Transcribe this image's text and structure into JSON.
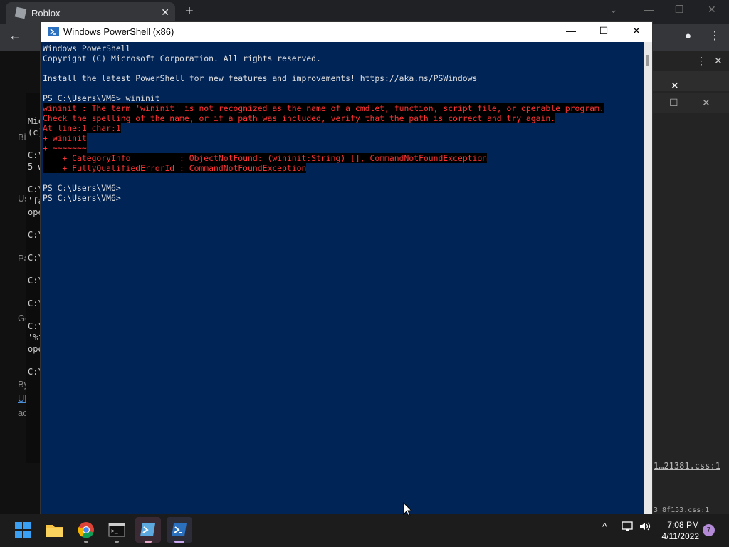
{
  "browser": {
    "tab_title": "Roblox",
    "tab_close": "✕",
    "new_tab": "+",
    "back": "←",
    "devtools_css_link": "1…21381.css:1",
    "devtools_css_link2": "3 8f153.css:1"
  },
  "background_cmd": {
    "lines": [
      "Mic",
      "(c)",
      "C:\\",
      "5 w",
      "C:\\",
      "'fa",
      "ope",
      "C:\\",
      "C:\\",
      "C:\\",
      "C:\\",
      "C:\\",
      "'%i",
      "ope",
      "C:\\"
    ]
  },
  "background_page_labels": [
    "Bi",
    "Us",
    "Pa",
    "Ge",
    "By",
    "Ul",
    "ac"
  ],
  "powershell": {
    "title": "Windows PowerShell (x86)",
    "minimize": "—",
    "maximize": "☐",
    "close": "✕",
    "lines": [
      {
        "text": "Windows PowerShell",
        "err": false
      },
      {
        "text": "Copyright (C) Microsoft Corporation. All rights reserved.",
        "err": false
      },
      {
        "text": "",
        "err": false
      },
      {
        "text": "Install the latest PowerShell for new features and improvements! https://aka.ms/PSWindows",
        "err": false
      },
      {
        "text": "",
        "err": false
      },
      {
        "text": "PS C:\\Users\\VM6> wininit",
        "err": false
      },
      {
        "text": "wininit : The term 'wininit' is not recognized as the name of a cmdlet, function, script file, or operable program.",
        "err": true
      },
      {
        "text": "Check the spelling of the name, or if a path was included, verify that the path is correct and try again.",
        "err": true
      },
      {
        "text": "At line:1 char:1",
        "err": true
      },
      {
        "text": "+ wininit",
        "err": true
      },
      {
        "text": "+ ~~~~~~~",
        "err": true
      },
      {
        "text": "    + CategoryInfo          : ObjectNotFound: (wininit:String) [], CommandNotFoundException",
        "err": true
      },
      {
        "text": "    + FullyQualifiedErrorId : CommandNotFoundException",
        "err": true
      },
      {
        "text": "",
        "err": false
      },
      {
        "text": "PS C:\\Users\\VM6>",
        "err": false
      },
      {
        "text": "PS C:\\Users\\VM6>",
        "err": false
      }
    ]
  },
  "taskbar": {
    "apps": [
      {
        "name": "start-button",
        "icon": "windows-logo-icon"
      },
      {
        "name": "file-explorer-button",
        "icon": "folder-icon"
      },
      {
        "name": "chrome-button",
        "icon": "chrome-icon"
      },
      {
        "name": "cmd-button",
        "icon": "terminal-icon"
      },
      {
        "name": "powershell-ise-button",
        "icon": "powershell-ise-icon"
      },
      {
        "name": "powershell-button",
        "icon": "powershell-icon"
      }
    ],
    "tray_chevron": "^",
    "time": "7:08 PM",
    "date": "4/11/2022",
    "notifications": "7"
  },
  "colors": {
    "ps_background": "#012456",
    "error_text": "#ff3333",
    "taskbar": "#1c1c1c"
  }
}
